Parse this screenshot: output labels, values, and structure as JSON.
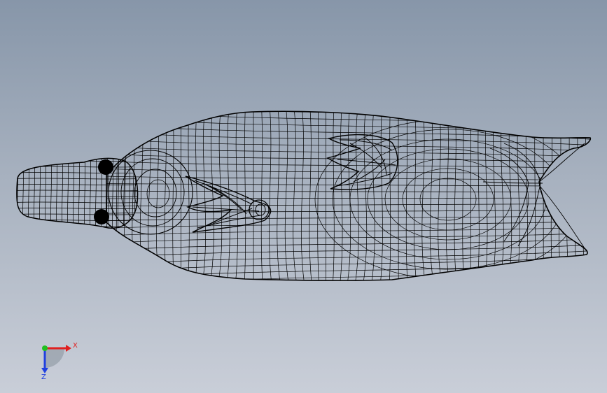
{
  "viewport": {
    "background_top": "#8796a9",
    "background_bottom": "#c9ced8",
    "render_mode": "wireframe",
    "wire_color": "#000000"
  },
  "model": {
    "shape": "duck-shaped mesh body viewed from top",
    "features": [
      "bill",
      "left-eye",
      "right-eye",
      "left-wing",
      "right-wing",
      "tail"
    ]
  },
  "triad": {
    "x_label": "X",
    "z_label": "Z",
    "x_color": "#e02020",
    "y_color": "#20c020",
    "z_color": "#2040e0"
  }
}
